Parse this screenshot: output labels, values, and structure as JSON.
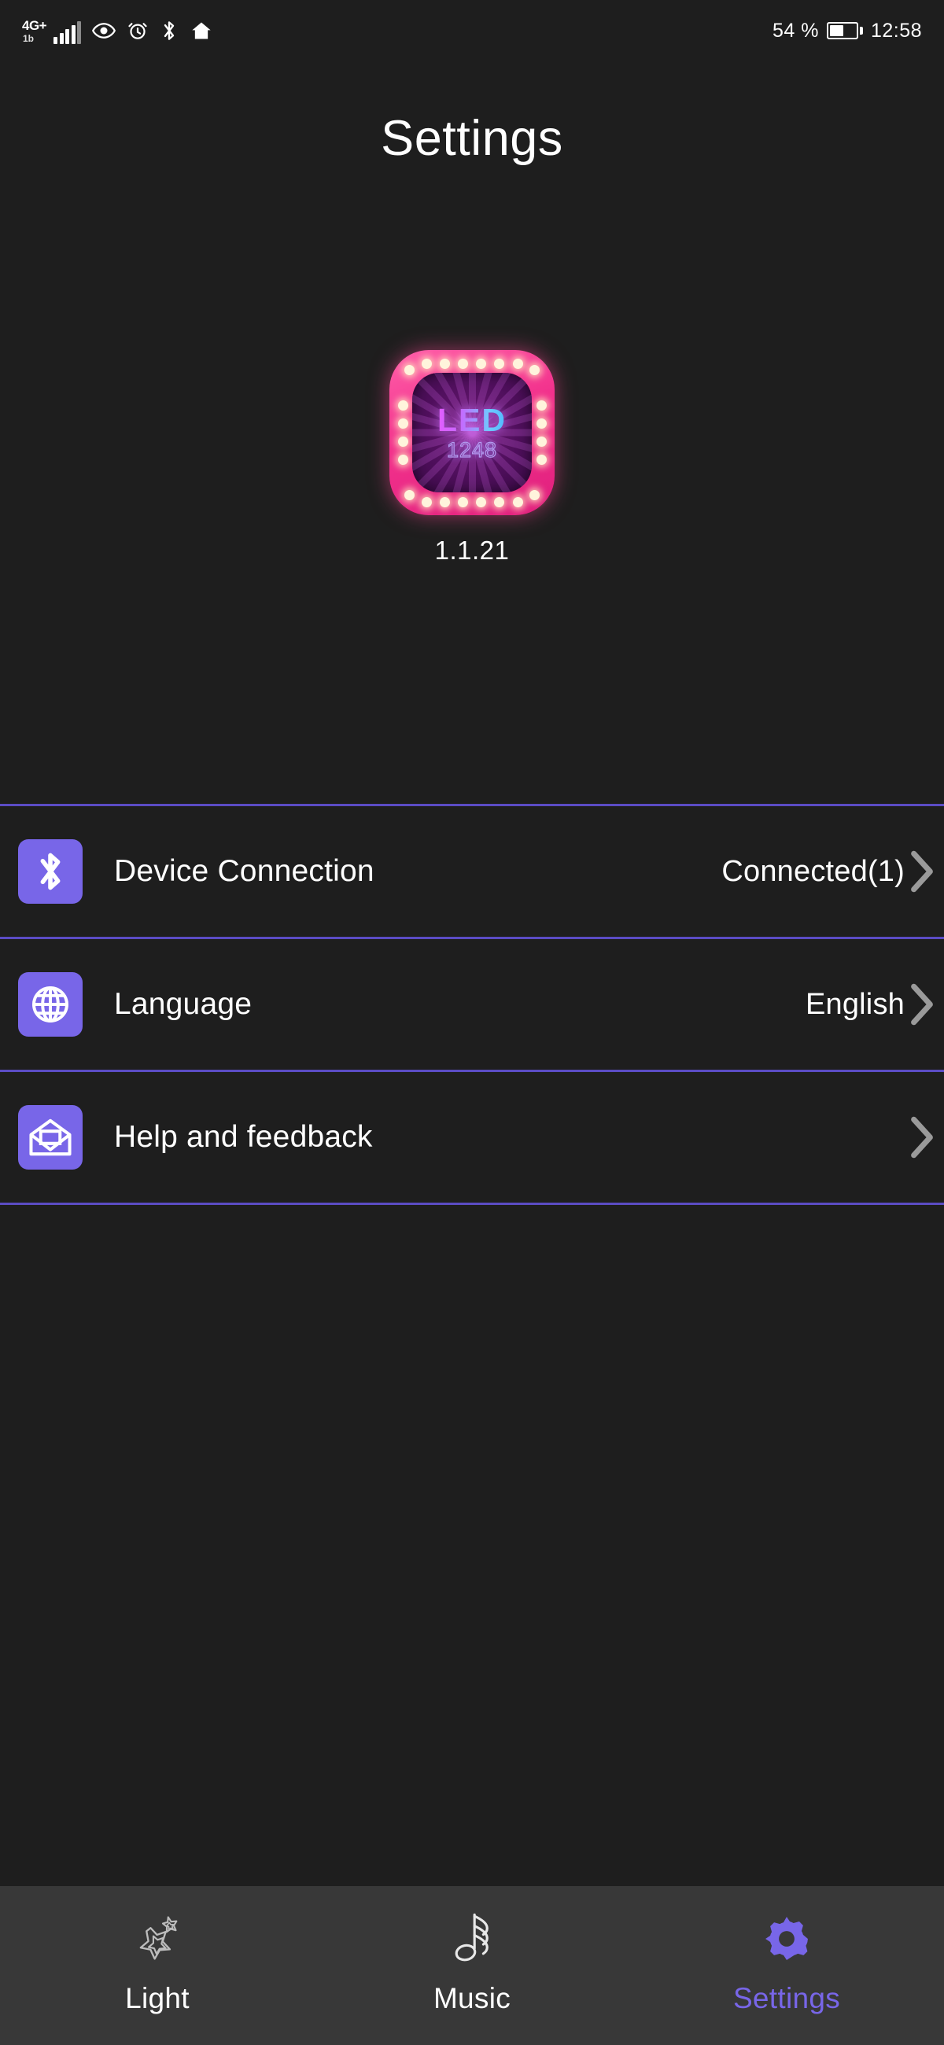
{
  "theme": {
    "page_bg": "#1e1e1e",
    "nav_bg": "#383838",
    "accent": "#7866e8",
    "divider": "#5b4cc4",
    "text": "#ffffff",
    "chevron": "#9a9a9a"
  },
  "status_bar": {
    "network_label": "4G+",
    "network_sub": "1b",
    "icons": [
      "signal-bars-icon",
      "eye-icon",
      "alarm-clock-icon",
      "bluetooth-icon",
      "home-icon"
    ],
    "battery_percent": "54 %",
    "battery_level": 54,
    "time": "12:58"
  },
  "header": {
    "title": "Settings"
  },
  "app_info": {
    "icon_text": "LED",
    "icon_number": "1248",
    "version": "1.1.21"
  },
  "settings_rows": [
    {
      "id": "device-connection",
      "icon": "bluetooth-icon",
      "label": "Device Connection",
      "value": "Connected(1)",
      "chevron": "chevron-right-icon"
    },
    {
      "id": "language",
      "icon": "globe-icon",
      "label": "Language",
      "value": "English",
      "chevron": "chevron-right-icon"
    },
    {
      "id": "help-and-feedback",
      "icon": "mail-envelope-icon",
      "label": "Help and feedback",
      "value": "",
      "chevron": "chevron-right-icon"
    }
  ],
  "bottom_nav": {
    "items": [
      {
        "id": "light",
        "label": "Light",
        "icon": "star-sparkle-icon",
        "active": false
      },
      {
        "id": "music",
        "label": "Music",
        "icon": "music-note-icon",
        "active": false
      },
      {
        "id": "settings",
        "label": "Settings",
        "icon": "gear-icon",
        "active": true
      }
    ]
  }
}
